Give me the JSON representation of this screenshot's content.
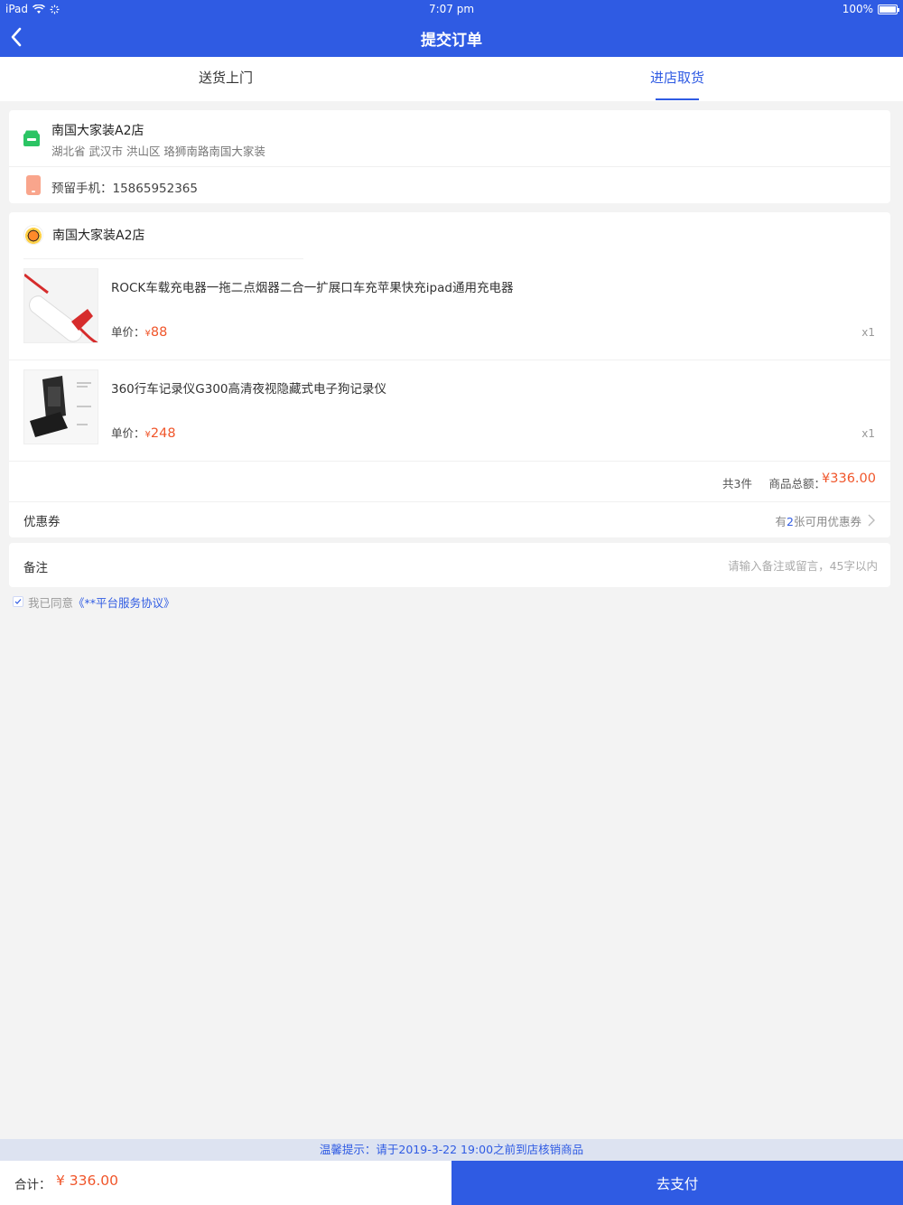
{
  "status_bar": {
    "device": "iPad",
    "time": "7:07 pm",
    "battery": "100%"
  },
  "nav": {
    "title": "提交订单"
  },
  "tabs": [
    {
      "label": "送货上门"
    },
    {
      "label": "进店取货"
    }
  ],
  "pickup_store": {
    "name": "南国大家装A2店",
    "address": "湖北省 武汉市 洪山区 珞狮南路南国大家装",
    "phone_label": "预留手机：15865952365"
  },
  "order": {
    "shop_name": "南国大家装A2店",
    "products": [
      {
        "name": "ROCK车载充电器一拖二点烟器二合一扩展口车充苹果快充ipad通用充电器",
        "price_label": "单价：",
        "currency": "¥",
        "price": "88",
        "qty": "x1"
      },
      {
        "name": "360行车记录仪G300高清夜视隐藏式电子狗记录仪",
        "price_label": "单价：",
        "currency": "¥",
        "price": "248",
        "qty": "x1"
      }
    ],
    "item_count": "共3件",
    "total_label": "商品总额：",
    "total": "¥336.00",
    "coupon_label": "优惠券",
    "coupon_prefix": "有",
    "coupon_count": "2",
    "coupon_suffix": "张可用优惠券"
  },
  "remark": {
    "label": "备注",
    "placeholder": "请输入备注或留言，45字以内"
  },
  "agreement": {
    "prefix": "我已同意",
    "link": "《**平台服务协议》",
    "checked": true
  },
  "tip": "温馨提示：请于2019-3-22 19:00之前到店核销商品",
  "footer": {
    "total_label": "合计：",
    "total": "¥ 336.00",
    "pay_label": "去支付"
  },
  "colors": {
    "primary": "#2f5be3",
    "price": "#f0562b",
    "shop_icon": "#2bc464",
    "phone_icon": "#f9a58c"
  }
}
